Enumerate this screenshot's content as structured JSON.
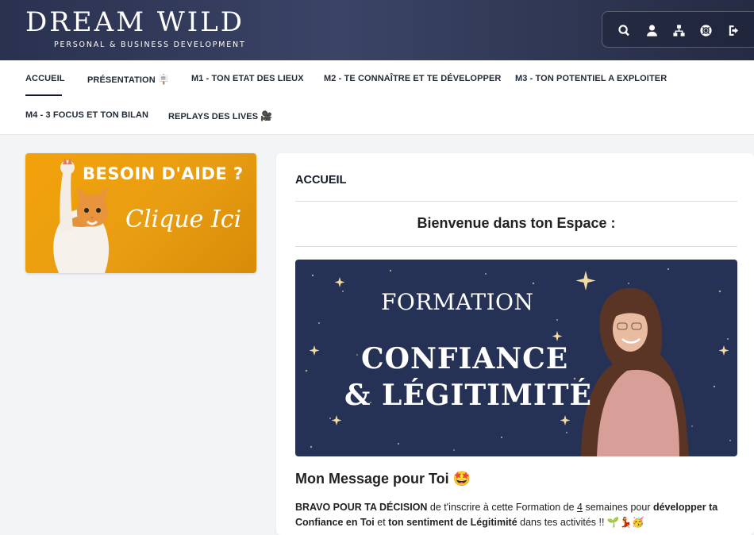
{
  "brand": {
    "title": "DREAM WILD",
    "subtitle": "PERSONAL & BUSINESS DEVELOPMENT"
  },
  "toolbar": {
    "icons": [
      "search-icon",
      "user-icon",
      "sitemap-icon",
      "life-ring-icon",
      "logout-icon"
    ]
  },
  "nav": {
    "items": [
      {
        "label": "ACCUEIL",
        "emoji": ""
      },
      {
        "label": "PRÉSENTATION",
        "emoji": "🪧"
      },
      {
        "label": "M1 - TON ETAT DES LIEUX",
        "emoji": ""
      },
      {
        "label": "M2 - TE CONNAÎTRE ET TE DÉVELOPPER",
        "emoji": ""
      },
      {
        "label": "M3 - TON POTENTIEL A EXPLOITER",
        "emoji": ""
      },
      {
        "label": "M4 - 3 FOCUS ET TON BILAN",
        "emoji": ""
      },
      {
        "label": "REPLAYS DES LIVES",
        "emoji": "🎥"
      }
    ],
    "active_index": 0
  },
  "help_banner": {
    "title": "BESOIN D'AIDE ?",
    "subtitle": "Clique Ici"
  },
  "main": {
    "heading": "ACCUEIL",
    "welcome": "Bienvenue dans ton Espace :",
    "hero": {
      "line1": "FORMATION",
      "line2": "CONFIANCE",
      "line3": "& LÉGITIMITÉ"
    },
    "message_title": "Mon Message pour Toi 🤩",
    "message": {
      "p1_bold": "BRAVO POUR TA DÉCISION",
      "p1_a": " de t'inscrire à cette Formation de ",
      "p1_num": "4",
      "p1_b": " semaines pour ",
      "p1_bold2": "développer ta Confiance en Toi",
      "p1_c": " et ",
      "p1_bold3": "ton sentiment de Légitimité",
      "p1_d": " dans tes activités !! 🌱💃🥳"
    }
  },
  "colors": {
    "header_bg": "#2f3755",
    "hero_bg": "#253155",
    "help_bg": "#f2a20a",
    "page_bg": "#f3f4f6"
  }
}
